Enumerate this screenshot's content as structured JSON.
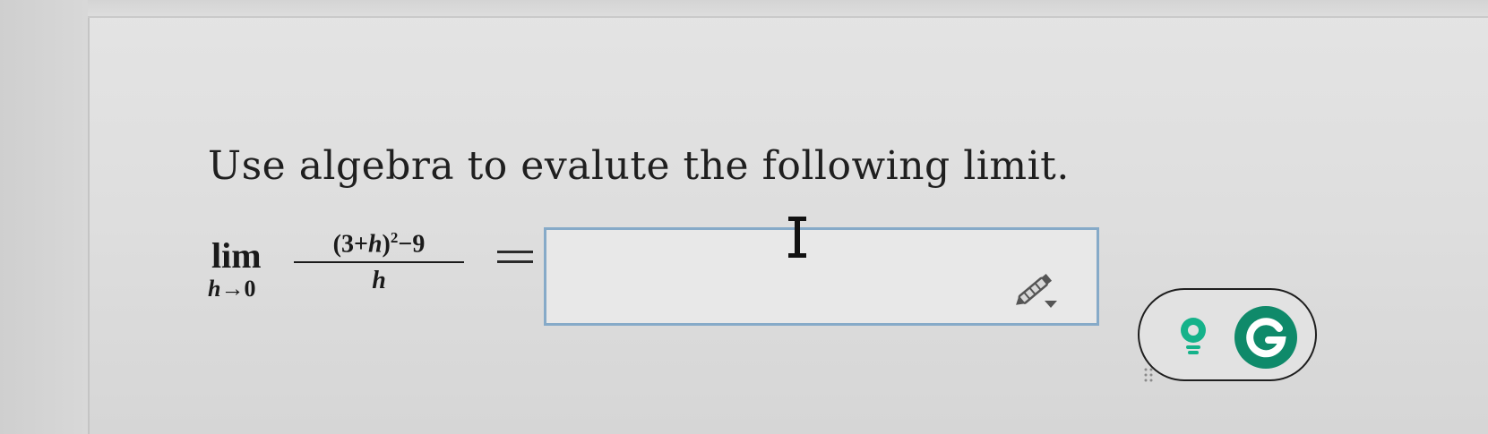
{
  "question": {
    "text": "Use algebra to evalute the following limit."
  },
  "expression": {
    "operator": "lim",
    "variable": "h",
    "arrow": "→",
    "approaches": "0",
    "numerator_base": "(3+",
    "numerator_var": "h",
    "numerator_close": ")",
    "exponent": "2",
    "numerator_tail": "−9",
    "denominator": "h"
  },
  "answer": {
    "value": "",
    "placeholder": ""
  },
  "icons": {
    "cursor": "text-cursor-icon",
    "pencil": "pencil-icon",
    "bulb": "lightbulb-icon",
    "grammarly": "grammarly-icon"
  },
  "colors": {
    "box_border": "#86aac8",
    "grammarly_green": "#0f8a6a",
    "bulb_green": "#15b28a",
    "text": "#1f1f1f"
  }
}
